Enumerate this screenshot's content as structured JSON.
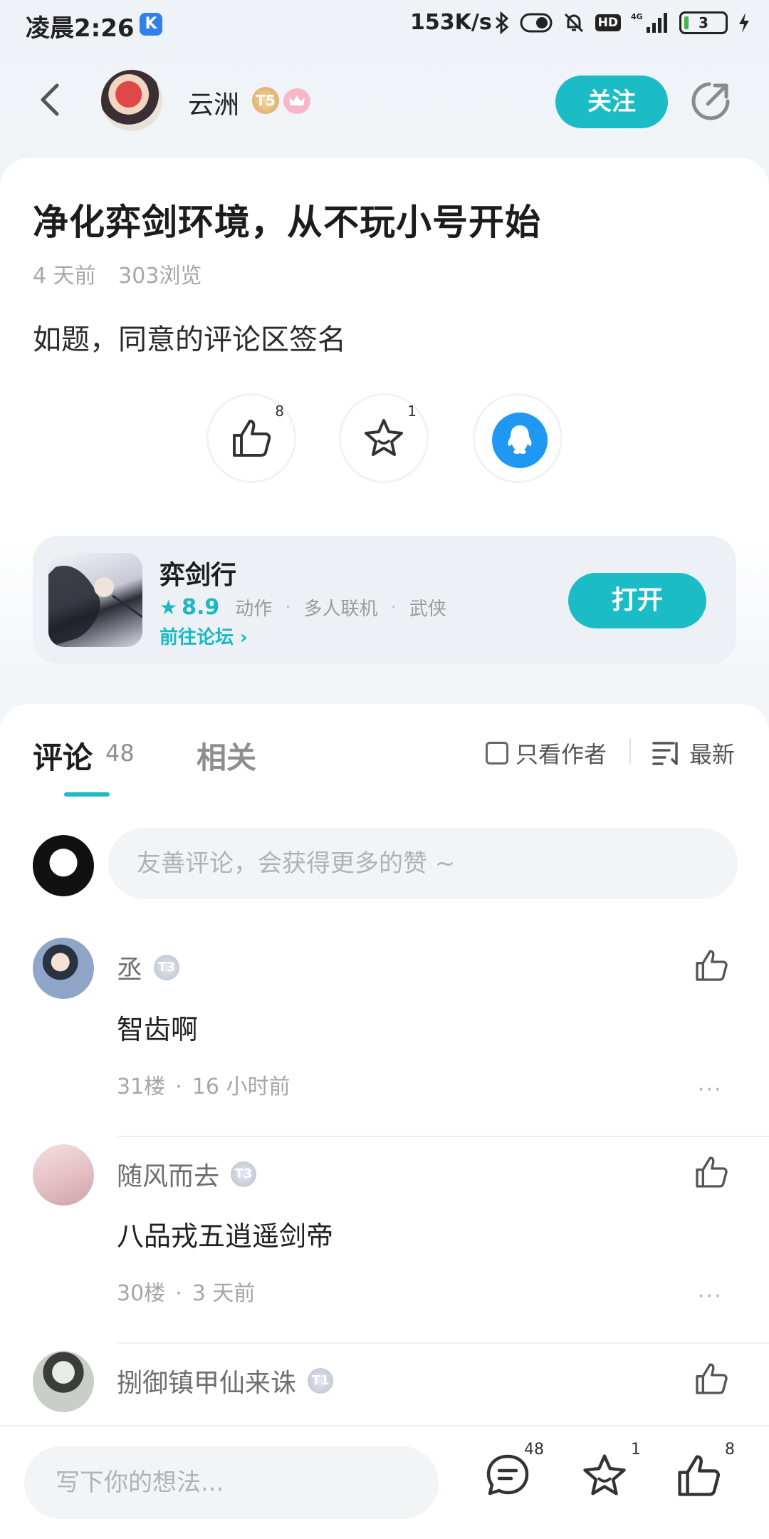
{
  "status_bar": {
    "time": "凌晨2:26",
    "k_badge": "K",
    "network_speed": "153K/s",
    "hd_label": "HD",
    "signal_label": "4G",
    "battery_level": "3"
  },
  "header": {
    "author_name": "云洲",
    "level_badge": "T5",
    "follow_label": "关注"
  },
  "post": {
    "title": "净化弈剑环境，从不玩小号开始",
    "time_ago": "4 天前",
    "views": "303浏览",
    "body": "如题，同意的评论区签名",
    "like_count": "8",
    "favorite_count": "1"
  },
  "game": {
    "name": "弈剑行",
    "rating": "8.9",
    "tags": [
      "动作",
      "多人联机",
      "武侠"
    ],
    "forum_link": "前往论坛 ›",
    "open_label": "打开"
  },
  "comments_section": {
    "tab_comments": "评论",
    "comments_count": "48",
    "tab_related": "相关",
    "only_author_label": "只看作者",
    "sort_label": "最新",
    "input_placeholder": "友善评论，会获得更多的赞 ~",
    "items": [
      {
        "user": "丞",
        "badge": "T3",
        "text": "智齿啊",
        "floor": "31楼",
        "time": "16 小时前",
        "avatar_color": "#8fa6c8"
      },
      {
        "user": "随风而去",
        "badge": "T3",
        "text": "八品戎五逍遥剑帝",
        "floor": "30楼",
        "time": "3 天前",
        "avatar_color": "#e6c2c6"
      },
      {
        "user": "捌御镇甲仙来诛",
        "badge": "T1",
        "text": "",
        "floor": "",
        "time": "",
        "avatar_color": "#c9cfc8"
      }
    ],
    "more_label": "···"
  },
  "bottom_bar": {
    "input_placeholder": "写下你的想法...",
    "comment_count": "48",
    "favorite_count": "1",
    "like_count": "8"
  },
  "colors": {
    "accent": "#1bbcc6",
    "qq_blue": "#1e98f2",
    "text_primary": "#1c1c1c",
    "text_secondary": "#a7a7a7"
  }
}
